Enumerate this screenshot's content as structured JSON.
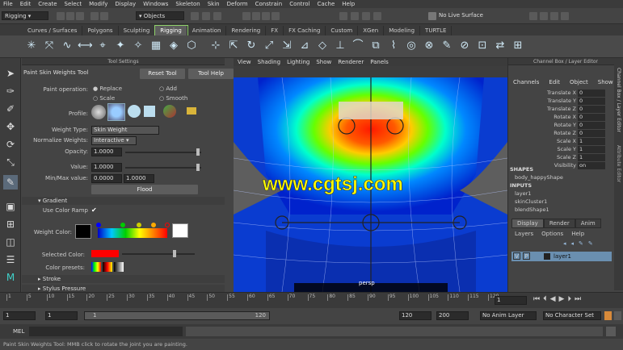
{
  "menubar": [
    "File",
    "Edit",
    "Create",
    "Select",
    "Modify",
    "Display",
    "Windows",
    "Skeleton",
    "Skin",
    "Deform",
    "Constrain",
    "Control",
    "Cache",
    "Help"
  ],
  "status": {
    "mode": "Rigging",
    "objects": "Objects",
    "live_surface": "No Live Surface"
  },
  "shelf_tabs": [
    "Curves / Surfaces",
    "Polygons",
    "Sculpting",
    "Rigging",
    "Animation",
    "Rendering",
    "FX",
    "FX Caching",
    "Custom",
    "XGen",
    "Modeling",
    "TURTLE"
  ],
  "active_shelf_tab": "Rigging",
  "tool_settings": {
    "header": "Tool Settings",
    "tool_name": "Paint Skin Weights Tool",
    "reset_button": "Reset Tool",
    "help_button": "Tool Help",
    "paint_operation_label": "Paint operation:",
    "op_replace": "Replace",
    "op_add": "Add",
    "op_scale": "Scale",
    "op_smooth": "Smooth",
    "profile_label": "Profile:",
    "weight_type_label": "Weight Type:",
    "weight_type_value": "Skin Weight",
    "normalize_label": "Normalize Weights:",
    "normalize_value": "Interactive",
    "opacity_label": "Opacity:",
    "opacity_value": "1.0000",
    "value_label": "Value:",
    "value_value": "1.0000",
    "minmax_label": "Min/Max value:",
    "min_value": "0.0000",
    "max_value": "1.0000",
    "flood_button": "Flood",
    "gradient_section": "Gradient",
    "use_color_ramp": "Use Color Ramp",
    "weight_color_label": "Weight Color:",
    "selected_color_label": "Selected Color:",
    "color_presets_label": "Color presets:",
    "stroke_section": "Stroke",
    "stylus_section": "Stylus Pressure"
  },
  "viewport": {
    "menu": [
      "View",
      "Shading",
      "Lighting",
      "Show",
      "Renderer",
      "Panels"
    ],
    "camera": "persp",
    "watermark": "www.cgtsj.com"
  },
  "channel_box": {
    "header": "Channel Box / Layer Editor",
    "menu": [
      "Channels",
      "Edit",
      "Object",
      "Show"
    ],
    "channels": [
      {
        "name": "Translate X",
        "value": "0"
      },
      {
        "name": "Translate Y",
        "value": "0"
      },
      {
        "name": "Translate Z",
        "value": "0"
      },
      {
        "name": "Rotate X",
        "value": "0"
      },
      {
        "name": "Rotate Y",
        "value": "0"
      },
      {
        "name": "Rotate Z",
        "value": "0"
      },
      {
        "name": "Scale X",
        "value": "1"
      },
      {
        "name": "Scale Y",
        "value": "1"
      },
      {
        "name": "Scale Z",
        "value": "1"
      },
      {
        "name": "Visibility",
        "value": "on"
      }
    ],
    "shapes_label": "SHAPES",
    "shape_name": "body_happyShape",
    "inputs_label": "INPUTS",
    "inputs": [
      "layer1",
      "skinCluster1",
      "blendShape1"
    ],
    "layer_tabs": [
      "Display",
      "Render",
      "Anim"
    ],
    "layer_menu": [
      "Layers",
      "Options",
      "Help"
    ],
    "layer_row": {
      "v": "V",
      "p": "P",
      "name": "layer1"
    },
    "side_tab_1": "Channel Box / Layer Editor",
    "side_tab_2": "Attribute Editor"
  },
  "timeline": {
    "ticks": [
      "1",
      "5",
      "10",
      "15",
      "20",
      "25",
      "30",
      "35",
      "40",
      "45",
      "50",
      "55",
      "60",
      "65",
      "70",
      "75",
      "80",
      "85",
      "90",
      "95",
      "100",
      "105",
      "110",
      "115",
      "120"
    ],
    "current_frame": "1"
  },
  "range": {
    "start": "1",
    "start2": "1",
    "slider_start": "1",
    "slider_end": "120",
    "end": "120",
    "end2": "200",
    "anim_layer": "No Anim Layer",
    "character_set": "No Character Set"
  },
  "command": {
    "label": "MEL"
  },
  "help_line": "Paint Skin Weights Tool: MMB click to rotate the joint you are painting."
}
